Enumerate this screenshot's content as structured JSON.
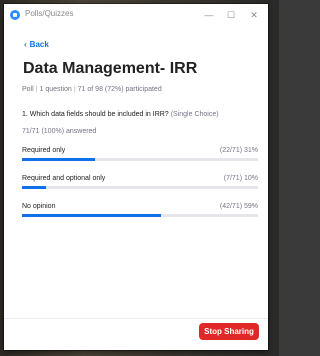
{
  "window": {
    "title": "Polls/Quizzes",
    "controls": {
      "minimize": "—",
      "maximize": "☐",
      "close": "✕"
    }
  },
  "nav": {
    "back_label": "Back",
    "back_icon": "‹"
  },
  "poll": {
    "title": "Data Management- IRR",
    "meta": {
      "type": "Poll",
      "questions": "1 question",
      "participation": "71 of 98 (72%) participated"
    },
    "question": {
      "text": "1. Which data fields should be included in IRR?",
      "type": "(Single Choice)"
    },
    "answered": "71/71 (100%) answered",
    "options": [
      {
        "label": "Required only",
        "stat": "(22/71) 31%",
        "fraction": 0.31
      },
      {
        "label": "Required and optional only",
        "stat": "(7/71) 10%",
        "fraction": 0.1
      },
      {
        "label": "No opinion",
        "stat": "(42/71) 59%",
        "fraction": 0.59
      }
    ]
  },
  "footer": {
    "stop_label": "Stop Sharing"
  },
  "colors": {
    "accent": "#0e71eb",
    "danger": "#e02828",
    "muted": "#747487"
  }
}
